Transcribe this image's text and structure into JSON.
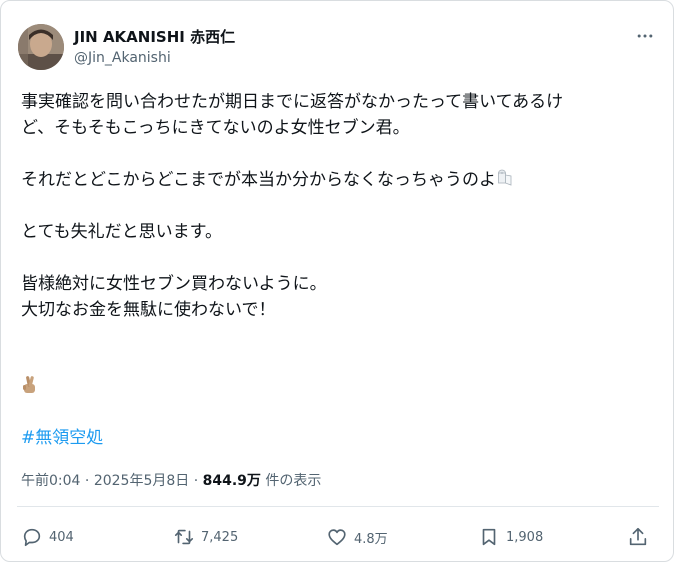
{
  "tweet": {
    "author": {
      "display_name": "JIN AKANISHI 赤西仁",
      "handle": "@Jin_Akanishi",
      "avatar_icon": "profile-photo"
    },
    "more_icon": "more-horizontal-icon",
    "body": {
      "line1": "事実確認を問い合わせたが期日までに返答がなかったって書いてあるけ",
      "line2": "ど、そもそもこっちにきてないのよ女性セブン君。",
      "line3": "それだとどこからどこまでが本当か分からなくなっちゃうのよ",
      "line4": "とても失礼だと思います。",
      "line5": "皆様絶対に女性セブン買わないように。",
      "line6": "大切なお金を無駄に使わないで！",
      "inline_emoji_icon": "toilet-paper-emoji",
      "hand_emoji_icon": "crossed-fingers-emoji"
    },
    "hashtag": "#無領空処",
    "meta": {
      "time": "午前0:04",
      "separator1": " · ",
      "date": "2025年5月8日",
      "separator2": " · ",
      "views_count": "844.9万",
      "views_label": " 件の表示"
    },
    "actions": {
      "reply_count": "404",
      "retweet_count": "7,425",
      "like_count": "4.8万",
      "bookmark_count": "1,908"
    },
    "colors": {
      "text": "#0f1419",
      "muted": "#536471",
      "link": "#1d9bf0",
      "divider": "#e1e6ea"
    }
  }
}
